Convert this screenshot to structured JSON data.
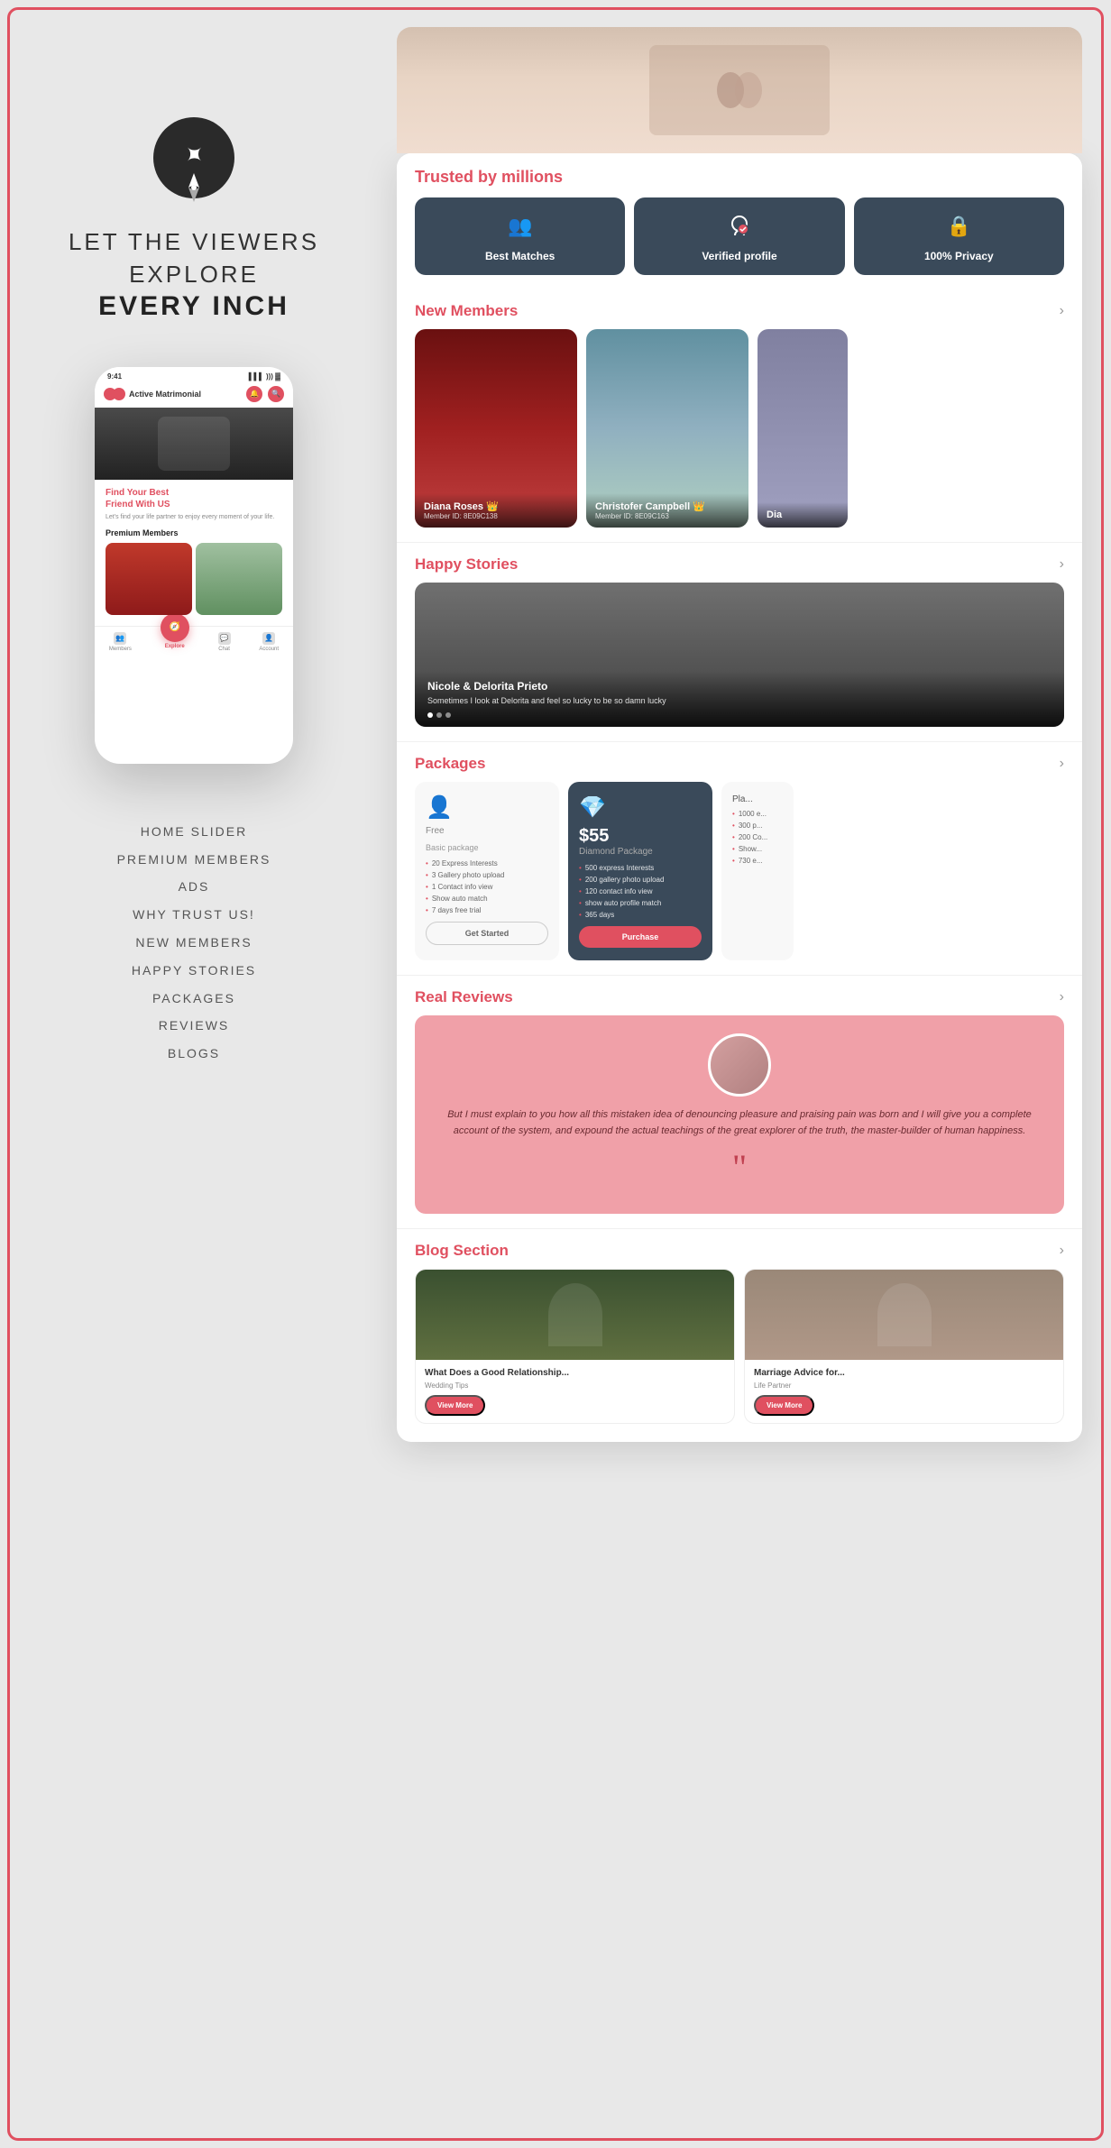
{
  "page": {
    "background_color": "#e8e8e8",
    "border_color": "#e05060"
  },
  "left": {
    "compass_label": "compass-icon",
    "tagline_line1": "LET THE VIEWERS",
    "tagline_line2": "EXPLORE",
    "tagline_bold": "EVERY INCH",
    "phone": {
      "time": "9:41",
      "app_name": "Active Matrimonial",
      "hero_cta_line1": "Find Your Best",
      "hero_cta_line2": "Friend With US",
      "sub_text": "Let's find your life partner to enjoy every moment of your life.",
      "premium_label": "Premium Members",
      "nav_items": [
        "Members",
        "Explore",
        "Chat",
        "Account"
      ]
    },
    "features": [
      "HOME SLIDER",
      "PREMIUM MEMBERS",
      "ADS",
      "WHY TRUST US!",
      "NEW MEMBERS",
      "HAPPY STORIES",
      "PACKAGES",
      "REVIEWS",
      "BLOGS"
    ]
  },
  "right": {
    "trusted": {
      "title": "Trusted by millions",
      "cards": [
        {
          "icon": "👥",
          "label": "Best Matches"
        },
        {
          "icon": "✓",
          "label": "Verified profile"
        },
        {
          "icon": "🔒",
          "label": "100% Privacy"
        }
      ]
    },
    "new_members": {
      "title": "New Members",
      "members": [
        {
          "name": "Diana Roses 👑",
          "id": "Member ID: 8E09C138"
        },
        {
          "name": "Christofer Campbell 👑",
          "id": "Member ID: 8E09C163"
        },
        {
          "name": "Dia",
          "id": ""
        }
      ]
    },
    "happy_stories": {
      "title": "Happy Stories",
      "story": {
        "names": "Nicole & Delorita Prieto",
        "quote": "Sometimes I look at Delorita and feel so lucky to be so damn lucky"
      }
    },
    "packages": {
      "title": "Packages",
      "free": {
        "name": "Free",
        "subtitle": "Basic package",
        "features": [
          "20 Express Interests",
          "3 Gallery photo upload",
          "1 Contact info view",
          "Show auto match",
          "7 days free trial"
        ],
        "btn": "Get Started"
      },
      "diamond": {
        "price": "$55",
        "name": "Diamond Package",
        "features": [
          "500 express Interests",
          "200 gallery photo upload",
          "120 contact info view",
          "show auto profile match",
          "365 days"
        ],
        "btn": "Purchase"
      },
      "plus": {
        "price": "Pla...",
        "features": [
          "1000 e...",
          "300 p...",
          "200 Co...",
          "Show...",
          "730 e..."
        ]
      }
    },
    "reviews": {
      "title": "Real Reviews",
      "review_text": "But I must explain to you how all this mistaken idea of denouncing pleasure and praising pain was born and I will give you a complete account of the system, and expound the actual teachings of the great explorer of the truth, the master-builder of human happiness.",
      "quote_icon": "””"
    },
    "blog": {
      "title": "Blog Section",
      "posts": [
        {
          "title": "What Does a Good Relationship...",
          "category": "Wedding Tips",
          "btn": "View More"
        },
        {
          "title": "Marriage Advice for...",
          "category": "Life Partner",
          "btn": "View More"
        }
      ]
    }
  }
}
